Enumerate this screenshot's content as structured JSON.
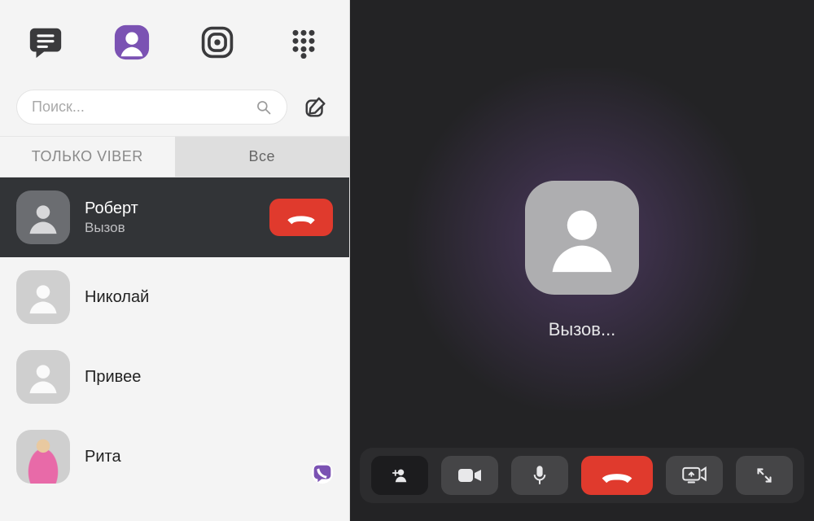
{
  "sidebar": {
    "search_placeholder": "Поиск...",
    "filters": {
      "viber_only": "ТОЛЬКО VIBER",
      "all": "Все"
    },
    "contacts": [
      {
        "name": "Роберт",
        "sub": "Вызов"
      },
      {
        "name": "Николай"
      },
      {
        "name": "Привее"
      },
      {
        "name": "Рита"
      }
    ]
  },
  "call": {
    "status": "Вызов..."
  },
  "colors": {
    "accent": "#7b52b3",
    "danger": "#e03a2d"
  }
}
